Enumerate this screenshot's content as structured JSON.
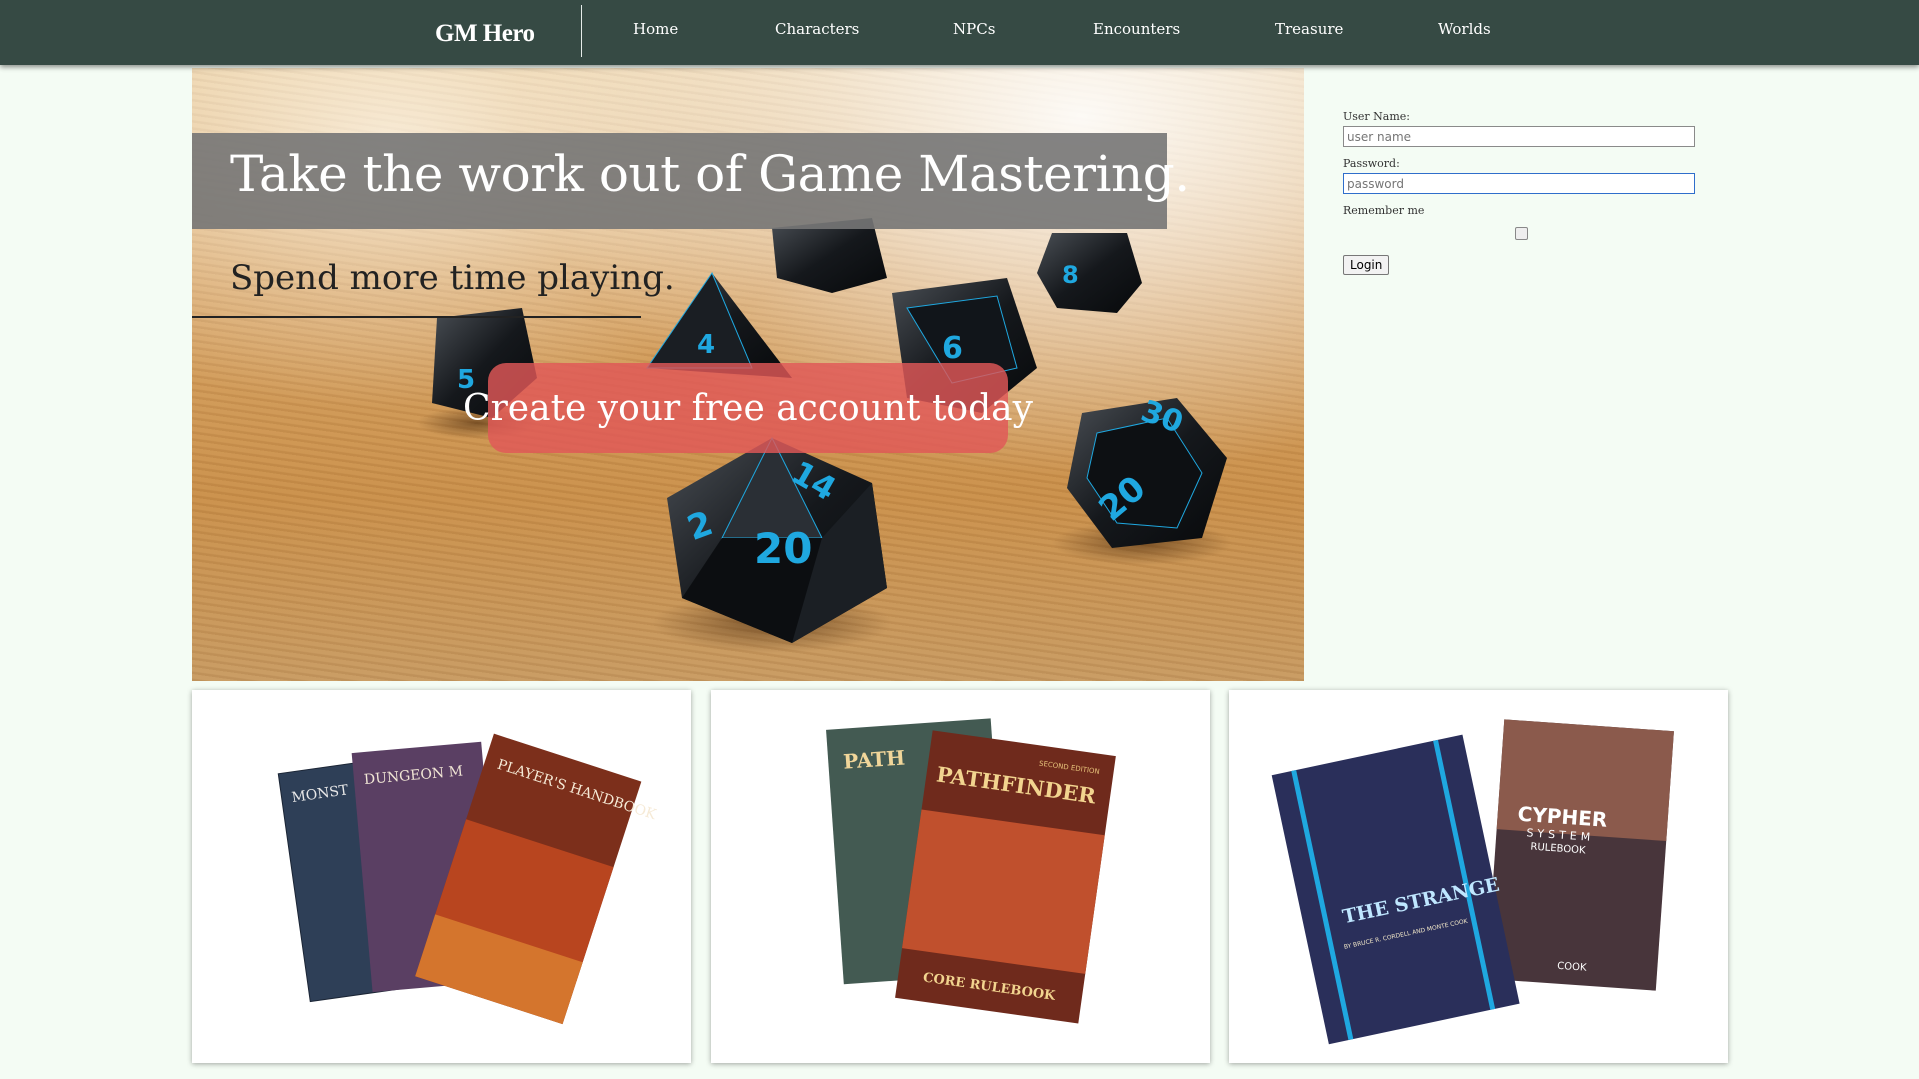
{
  "nav": {
    "brand": "GM Hero",
    "items": [
      {
        "label": "Home"
      },
      {
        "label": "Characters"
      },
      {
        "label": "NPCs"
      },
      {
        "label": "Encounters"
      },
      {
        "label": "Treasure"
      },
      {
        "label": "Worlds"
      }
    ]
  },
  "hero": {
    "title": "Take the work out of Game Mastering.",
    "subtitle": "Spend more time playing.",
    "cta_label": "Create your free account today",
    "dice_numbers": [
      "20",
      "14",
      "2",
      "30",
      "20",
      "6",
      "4",
      "8",
      "5"
    ]
  },
  "login": {
    "username_label": "User Name:",
    "username_placeholder": "user name",
    "password_label": "Password:",
    "password_placeholder": "password",
    "remember_label": "Remember me",
    "remember_checked": false,
    "submit_label": "Login"
  },
  "books": {
    "dnd": {
      "covers": [
        "MONST",
        "DUNGEON M",
        "PLAYER'S HANDBOOK"
      ]
    },
    "pathfinder": {
      "covers": [
        "PATH",
        "PATHFINDER",
        "CORE RULEBOOK"
      ],
      "edition": "SECOND EDITION"
    },
    "cypher": {
      "covers": [
        "THE STRANGE",
        "CYPHER",
        "SYSTEM",
        "RULEBOOK"
      ],
      "authors": "BY BRUCE R. CORDELL AND MONTE COOK",
      "footer": "COOK"
    }
  },
  "colors": {
    "nav_bg": "#364a44",
    "page_bg": "#f4fcf4",
    "cta_bg": "#e05858",
    "dice_accent": "#1fa8e0"
  }
}
